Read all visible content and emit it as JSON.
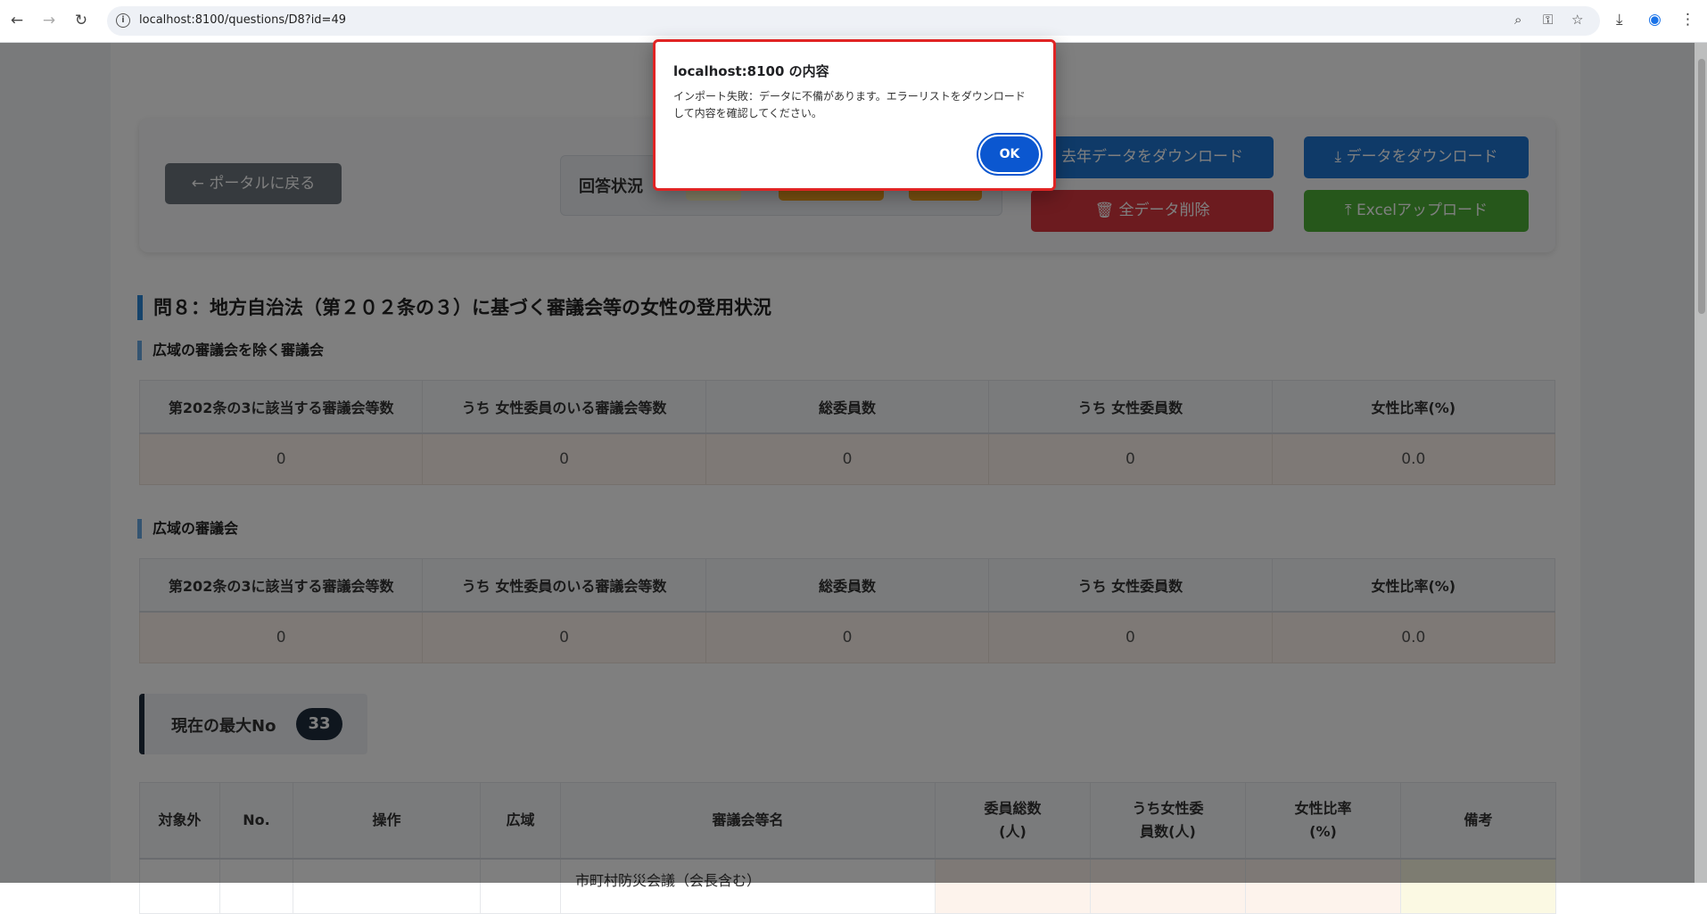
{
  "browser": {
    "url": "localhost:8100/questions/D8?id=49"
  },
  "toolbar": {
    "back_label": "← ポータルに戻る",
    "status_label": "回答状況",
    "download_last_year_label": "去年データをダウンロード",
    "download_label": "データをダウンロード",
    "delete_all_label": "全データ削除",
    "excel_upload_label": "Excelアップロード"
  },
  "question": {
    "title": "問８：地方自治法（第２０２条の３）に基づく審議会等の女性の登用状況"
  },
  "section1": {
    "title": "広域の審議会を除く審議会",
    "headers": [
      "第202条の3に該当する審議会等数",
      "うち 女性委員のいる審議会等数",
      "総委員数",
      "うち 女性委員数",
      "女性比率(%)"
    ],
    "values": [
      "0",
      "0",
      "0",
      "0",
      "0.0"
    ]
  },
  "section2": {
    "title": "広域の審議会",
    "headers": [
      "第202条の3に該当する審議会等数",
      "うち 女性委員のいる審議会等数",
      "総委員数",
      "うち 女性委員数",
      "女性比率(%)"
    ],
    "values": [
      "0",
      "0",
      "0",
      "0",
      "0.0"
    ]
  },
  "maxno": {
    "label": "現在の最大No",
    "value": "33"
  },
  "list_table": {
    "headers": [
      "対象外",
      "No.",
      "操作",
      "広域",
      "審議会等名",
      "委員総数\n(人)",
      "うち女性委\n員数(人)",
      "女性比率\n(%)",
      "備考"
    ],
    "first_row_name": "市町村防災会議（会長含む）"
  },
  "dialog": {
    "title": "localhost:8100 の内容",
    "message": "インポート失敗：データに不備があります。エラーリストをダウンロードして内容を確認してください。",
    "ok_label": "OK"
  },
  "colors": {
    "primary_blue": "#1f74d0",
    "danger_red": "#d9363e",
    "success_green": "#4caf37",
    "secondary_gray": "#6c757d",
    "dialog_border": "#e02424"
  }
}
